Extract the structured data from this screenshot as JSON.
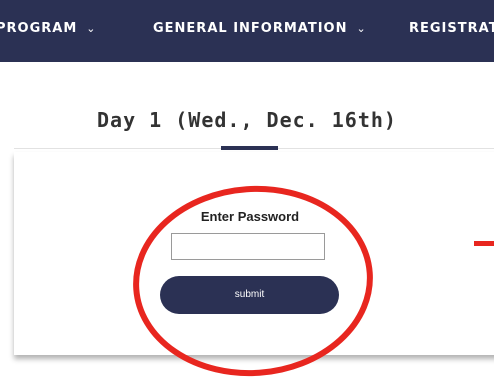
{
  "nav": {
    "items": [
      {
        "label": "PROGRAM",
        "chevron": "⌄"
      },
      {
        "label": "GENERAL INFORMATION",
        "chevron": "⌄"
      },
      {
        "label": "REGISTRATION"
      }
    ]
  },
  "section": {
    "title": "Day 1 (Wed., Dec. 16th)"
  },
  "password_form": {
    "label": "Enter Password",
    "input_value": "",
    "submit_label": "submit"
  },
  "colors": {
    "brand_navy": "#2b3154",
    "annotation_red": "#e8261f"
  },
  "icons": {
    "dropdown": "chevron-down-icon"
  }
}
